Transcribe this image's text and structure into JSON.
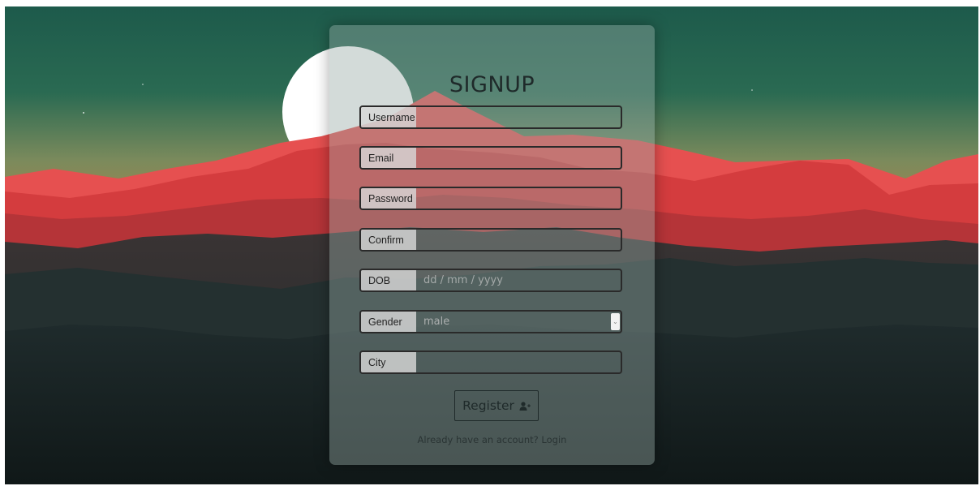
{
  "form": {
    "title": "SIGNUP",
    "fields": [
      {
        "label": "Username",
        "placeholder": "",
        "type": "text"
      },
      {
        "label": "Email",
        "placeholder": "",
        "type": "text"
      },
      {
        "label": "Password",
        "placeholder": "",
        "type": "password"
      },
      {
        "label": "Confirm",
        "placeholder": "",
        "type": "password"
      },
      {
        "label": "DOB",
        "placeholder": "dd / mm / yyyy",
        "type": "text"
      },
      {
        "label": "Gender",
        "value": "male",
        "type": "select"
      },
      {
        "label": "City",
        "placeholder": "",
        "type": "text"
      }
    ],
    "register_label": "Register",
    "register_icon": "user-plus-icon",
    "login_prompt": "Already have an account?",
    "login_link": "Login"
  },
  "background": {
    "icon": "mountain-landscape",
    "sky_top": "#1f5a4a",
    "sky_mid": "#7a8a5a",
    "mountain_red": "#e04848",
    "mountain_dark": "#1e2a2a",
    "moon": "#ffffff"
  }
}
